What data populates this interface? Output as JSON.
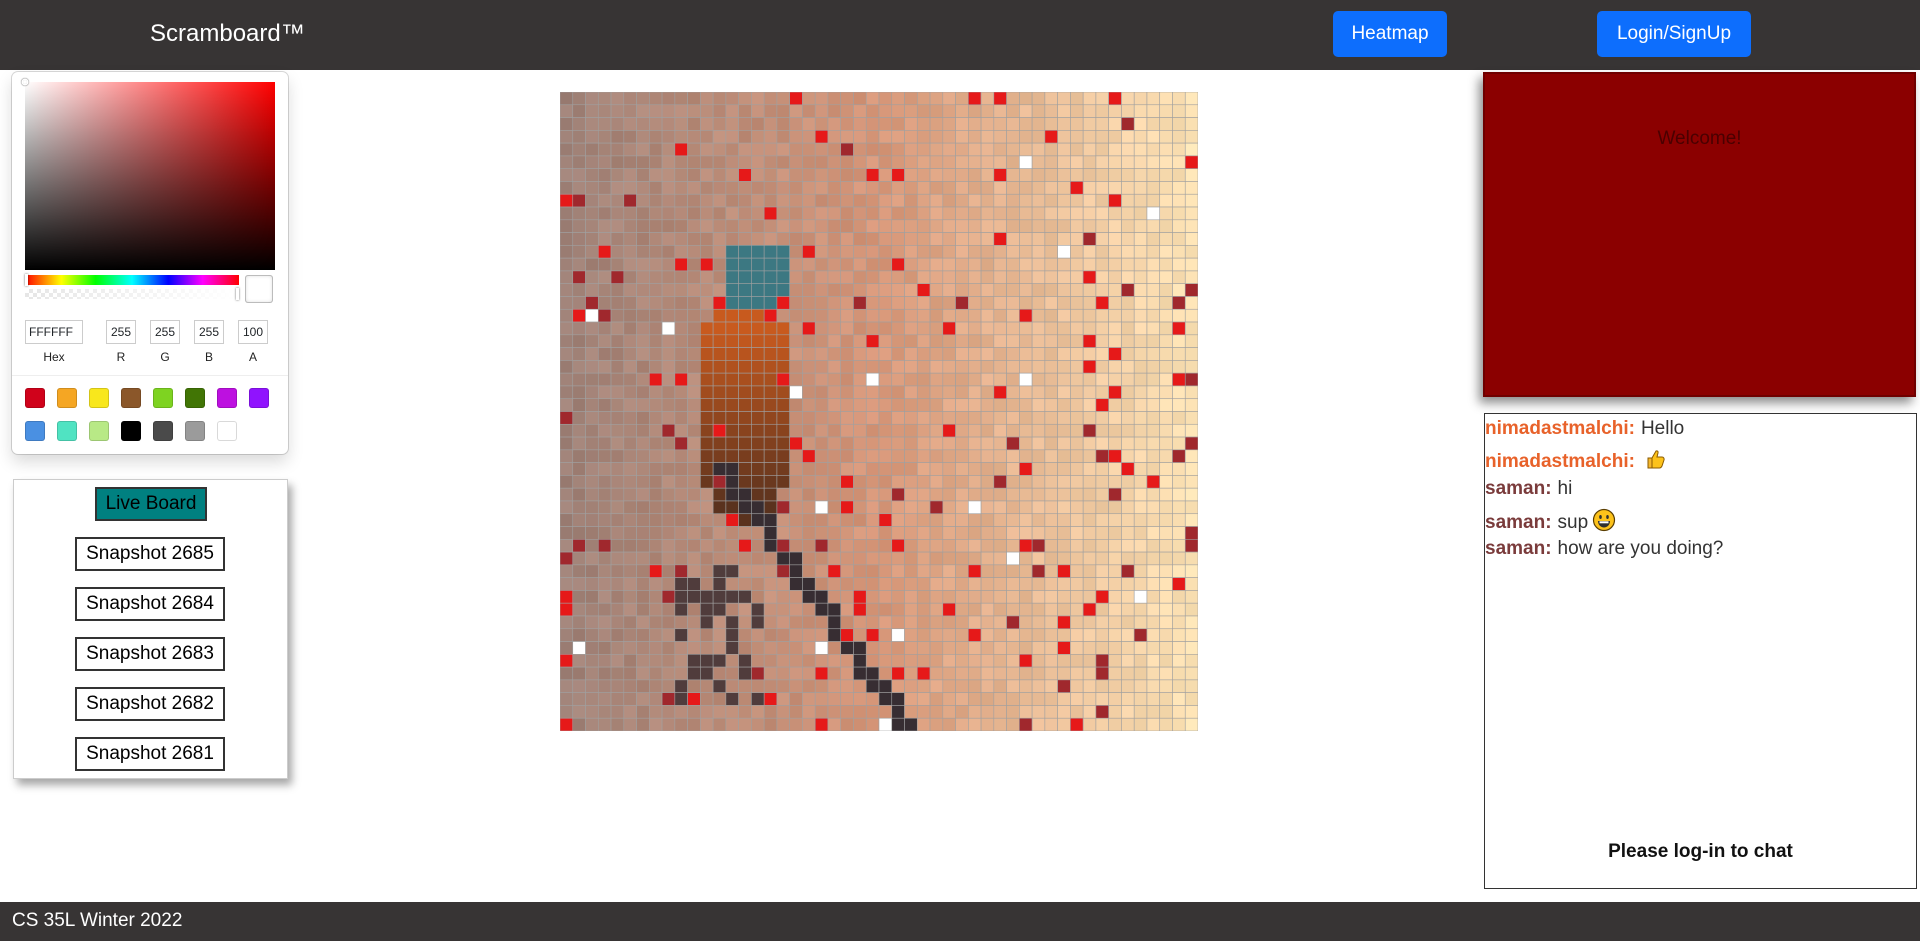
{
  "navbar": {
    "brand": "Scramboard™",
    "heatmap_label": "Heatmap",
    "login_label": "Login/SignUp",
    "background": "#373434",
    "button_color": "#0d6efd"
  },
  "color_picker": {
    "hex": "FFFFFF",
    "r": "255",
    "g": "255",
    "b": "255",
    "a": "100",
    "labels": {
      "hex": "Hex",
      "r": "R",
      "g": "G",
      "b": "B",
      "a": "A"
    },
    "hue_color": "#ff0000",
    "selected_color": "#ffffff",
    "swatches": [
      "#d0021b",
      "#f5a623",
      "#f8e71c",
      "#8b572a",
      "#7ed321",
      "#417505",
      "#bd10e0",
      "#9013fe",
      "#4a90e2",
      "#50e3c2",
      "#b8e986",
      "#000000",
      "#4a4a4a",
      "#9b9b9b",
      "#ffffff"
    ]
  },
  "snapshots": {
    "live_label": "Live Board",
    "live_color": "#008080",
    "items": [
      "Snapshot 2685",
      "Snapshot 2684",
      "Snapshot 2683",
      "Snapshot 2682",
      "Snapshot 2681"
    ]
  },
  "board": {
    "grid_size": 50,
    "gridline_color": "#a0a0a0"
  },
  "welcome": {
    "text": "Welcome!",
    "background": "#8b0000"
  },
  "chat": {
    "messages": [
      {
        "user": "nimadastmalchi:",
        "text": "Hello",
        "emoji": "",
        "user_color": "#e8622a"
      },
      {
        "user": "nimadastmalchi:",
        "text": "",
        "emoji": "thumbs-up",
        "user_color": "#e8622a"
      },
      {
        "user": "saman:",
        "text": "hi",
        "emoji": "",
        "user_color": "#7a3b3b"
      },
      {
        "user": "saman:",
        "text": "sup",
        "emoji": "grinning-face",
        "user_color": "#7a3b3b"
      },
      {
        "user": "saman:",
        "text": "how are you doing?",
        "emoji": "",
        "user_color": "#7a3b3b"
      }
    ],
    "login_hint": "Please log-in to chat"
  },
  "footer": {
    "text": "CS 35L Winter 2022"
  }
}
